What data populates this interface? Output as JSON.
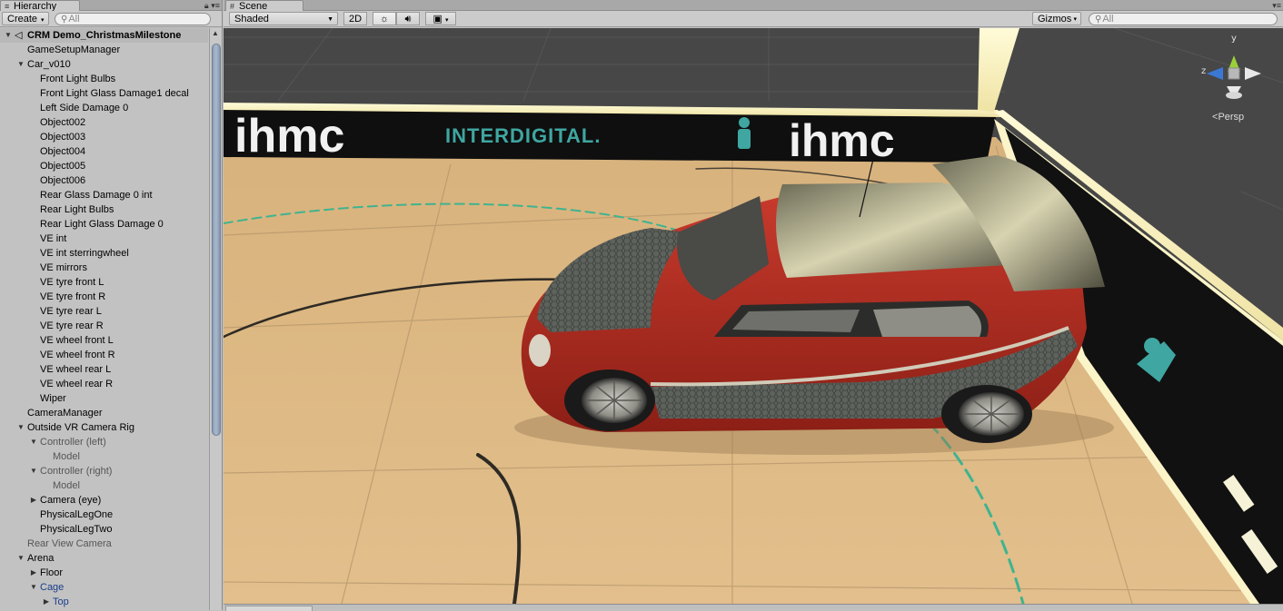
{
  "hierarchy": {
    "tab_title": "Hierarchy",
    "create_label": "Create",
    "search_placeholder": "All",
    "items": [
      {
        "label": "CRM Demo_ChristmasMilestone",
        "depth": 0,
        "arrow": "down",
        "kind": "scene"
      },
      {
        "label": "GameSetupManager",
        "depth": 1,
        "arrow": "none"
      },
      {
        "label": "Car_v010",
        "depth": 1,
        "arrow": "down"
      },
      {
        "label": "Front Light Bulbs",
        "depth": 2,
        "arrow": "none"
      },
      {
        "label": "Front Light Glass Damage1 decal",
        "depth": 2,
        "arrow": "none"
      },
      {
        "label": "Left Side Damage 0",
        "depth": 2,
        "arrow": "none"
      },
      {
        "label": "Object002",
        "depth": 2,
        "arrow": "none"
      },
      {
        "label": "Object003",
        "depth": 2,
        "arrow": "none"
      },
      {
        "label": "Object004",
        "depth": 2,
        "arrow": "none"
      },
      {
        "label": "Object005",
        "depth": 2,
        "arrow": "none"
      },
      {
        "label": "Object006",
        "depth": 2,
        "arrow": "none"
      },
      {
        "label": "Rear Glass Damage 0 int",
        "depth": 2,
        "arrow": "none"
      },
      {
        "label": "Rear Light Bulbs",
        "depth": 2,
        "arrow": "none"
      },
      {
        "label": "Rear Light Glass Damage 0",
        "depth": 2,
        "arrow": "none"
      },
      {
        "label": "VE int",
        "depth": 2,
        "arrow": "none"
      },
      {
        "label": "VE int sterringwheel",
        "depth": 2,
        "arrow": "none"
      },
      {
        "label": "VE mirrors",
        "depth": 2,
        "arrow": "none"
      },
      {
        "label": "VE tyre front L",
        "depth": 2,
        "arrow": "none"
      },
      {
        "label": "VE tyre front R",
        "depth": 2,
        "arrow": "none"
      },
      {
        "label": "VE tyre rear L",
        "depth": 2,
        "arrow": "none"
      },
      {
        "label": "VE tyre rear R",
        "depth": 2,
        "arrow": "none"
      },
      {
        "label": "VE wheel front L",
        "depth": 2,
        "arrow": "none"
      },
      {
        "label": "VE wheel front R",
        "depth": 2,
        "arrow": "none"
      },
      {
        "label": "VE wheel rear L",
        "depth": 2,
        "arrow": "none"
      },
      {
        "label": "VE wheel rear R",
        "depth": 2,
        "arrow": "none"
      },
      {
        "label": "Wiper",
        "depth": 2,
        "arrow": "none"
      },
      {
        "label": "CameraManager",
        "depth": 1,
        "arrow": "none"
      },
      {
        "label": "Outside VR Camera Rig",
        "depth": 1,
        "arrow": "down"
      },
      {
        "label": "Controller (left)",
        "depth": 2,
        "arrow": "down",
        "kind": "dim"
      },
      {
        "label": "Model",
        "depth": 3,
        "arrow": "none",
        "kind": "dim"
      },
      {
        "label": "Controller (right)",
        "depth": 2,
        "arrow": "down",
        "kind": "dim"
      },
      {
        "label": "Model",
        "depth": 3,
        "arrow": "none",
        "kind": "dim"
      },
      {
        "label": "Camera (eye)",
        "depth": 2,
        "arrow": "right"
      },
      {
        "label": "PhysicalLegOne",
        "depth": 2,
        "arrow": "none"
      },
      {
        "label": "PhysicalLegTwo",
        "depth": 2,
        "arrow": "none"
      },
      {
        "label": "Rear View Camera",
        "depth": 1,
        "arrow": "none",
        "kind": "dim"
      },
      {
        "label": "Arena",
        "depth": 1,
        "arrow": "down"
      },
      {
        "label": "Floor",
        "depth": 2,
        "arrow": "right"
      },
      {
        "label": "Cage",
        "depth": 2,
        "arrow": "down",
        "kind": "blue"
      },
      {
        "label": "Top",
        "depth": 3,
        "arrow": "right",
        "kind": "blue"
      }
    ]
  },
  "scene": {
    "tab_title": "Scene",
    "shading_mode": "Shaded",
    "mode_2d_label": "2D",
    "gizmos_label": "Gizmos",
    "search_placeholder": "All",
    "banner_text_1": "ihmc",
    "banner_text_2": "INTERDIGITAL.",
    "banner_text_3": "ihmc",
    "gizmo": {
      "y_label": "y",
      "z_label": "z",
      "projection_label": "Persp"
    }
  },
  "colors": {
    "panel_bg": "#c2c2c2",
    "scrollbar_thumb": "#8da0b8",
    "car_body": "#b3281e",
    "floor": "#dcb57e",
    "banner_teal": "#3fa6a1",
    "selected_blue": "#1a3d8a"
  },
  "icons": {
    "scene_icon": "unity-logo-icon",
    "lock": "lock-icon",
    "menu": "panel-menu-icon",
    "sun": "lighting-toggle-icon",
    "audio": "audio-toggle-icon",
    "image": "effects-toggle-icon"
  }
}
